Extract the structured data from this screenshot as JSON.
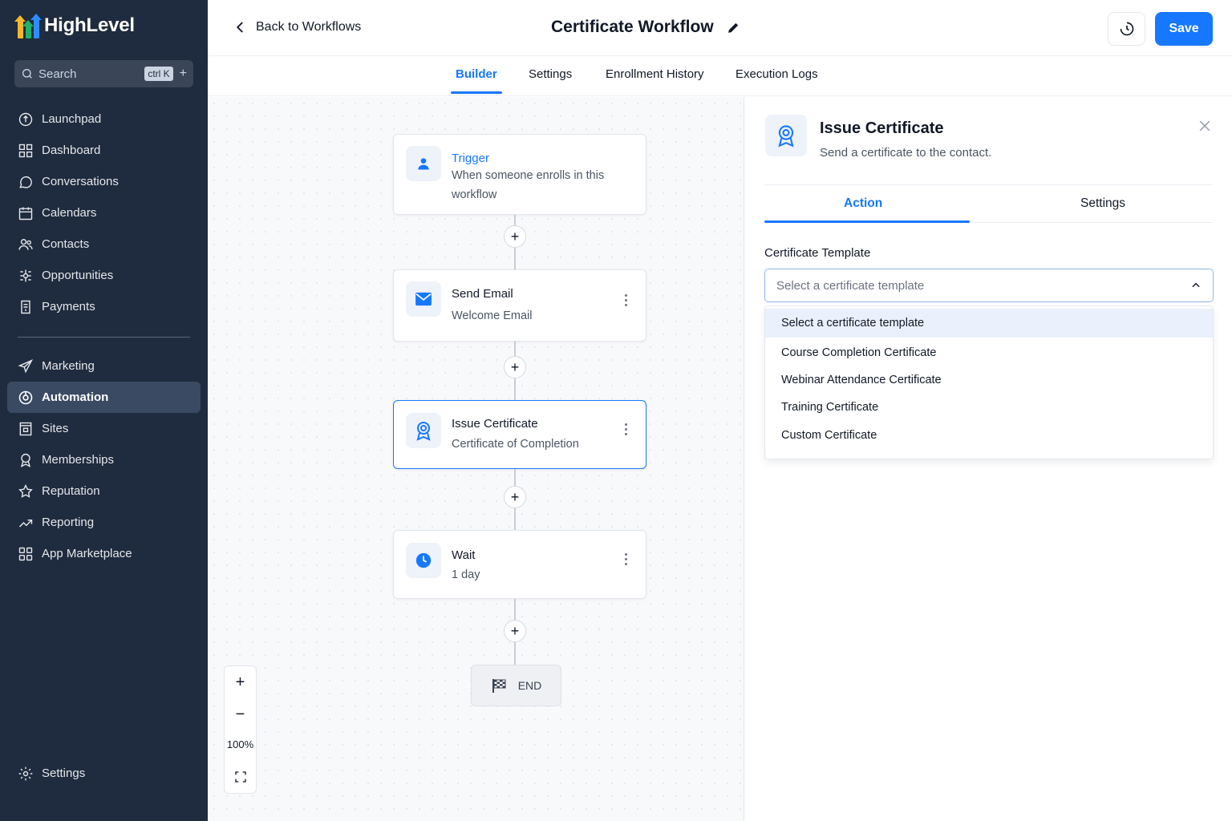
{
  "brand": {
    "name": "HighLevel",
    "colors": [
      "#f6b82b",
      "#1fb36a",
      "#2f8cff"
    ]
  },
  "search": {
    "placeholder": "Search",
    "shortcut": "ctrl K",
    "add": "+"
  },
  "nav": {
    "group1": [
      "Launchpad",
      "Dashboard",
      "Conversations",
      "Calendars",
      "Contacts",
      "Opportunities",
      "Payments"
    ],
    "group2": [
      "Marketing",
      "Automation",
      "Sites",
      "Memberships",
      "Reputation",
      "Reporting",
      "App Marketplace"
    ],
    "active": "Automation",
    "settings": "Settings"
  },
  "header": {
    "back_label": "Back to Workflows",
    "title": "Certificate Workflow",
    "save_label": "Save"
  },
  "tabs": [
    "Builder",
    "Settings",
    "Enrollment History",
    "Execution Logs"
  ],
  "active_tab": "Builder",
  "workflow": {
    "trigger": {
      "title": "Trigger",
      "subtitle": "When someone enrolls in this workflow"
    },
    "steps": [
      {
        "title": "Send Email",
        "subtitle": "Welcome Email",
        "icon": "mail-icon"
      },
      {
        "title": "Issue Certificate",
        "subtitle": "Certificate of Completion",
        "icon": "award-icon",
        "selected": true
      },
      {
        "title": "Wait",
        "subtitle": "1 day",
        "icon": "clock-icon"
      }
    ],
    "end_label": "END"
  },
  "zoom": {
    "plus": "+",
    "minus": "−",
    "level": "100%"
  },
  "panel": {
    "title": "Issue Certificate",
    "subtitle": "Send a certificate to the contact.",
    "tabs": [
      "Action",
      "Settings"
    ],
    "active_tab": "Action",
    "field_label": "Certificate Template",
    "select_placeholder": "Select a certificate template",
    "options": [
      "Select a certificate template",
      "Course Completion Certificate",
      "Webinar Attendance Certificate",
      "Training Certificate",
      "Custom Certificate"
    ]
  },
  "colors": {
    "accent": "#1677ff",
    "sidebar_bg": "#1f2b3e",
    "sidebar_active": "#3a4a63"
  }
}
